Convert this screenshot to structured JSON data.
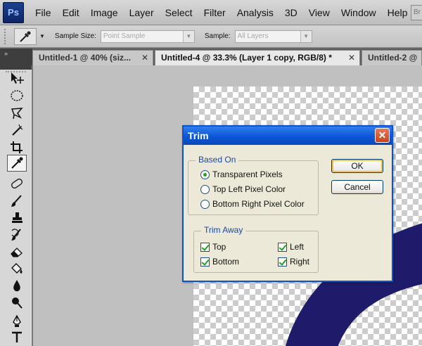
{
  "app": {
    "logo": "Ps"
  },
  "menu": [
    "File",
    "Edit",
    "Image",
    "Layer",
    "Select",
    "Filter",
    "Analysis",
    "3D",
    "View",
    "Window",
    "Help"
  ],
  "menu_right_button": "Br",
  "options": {
    "sample_size_label": "Sample Size:",
    "sample_size_value": "Point Sample",
    "sample_label": "Sample:",
    "sample_value": "All Layers"
  },
  "panel_collapse": "»",
  "tabs": [
    {
      "label": "Untitled-1 @ 40% (siz...",
      "active": false
    },
    {
      "label": "Untitled-4 @ 33.3% (Layer 1 copy, RGB/8) *",
      "active": true
    },
    {
      "label": "Untitled-2 @",
      "active": false
    }
  ],
  "tab_close": "✕",
  "dialog": {
    "title": "Trim",
    "close": "✕",
    "based_on": {
      "title": "Based On",
      "options": [
        {
          "label": "Transparent Pixels",
          "selected": true
        },
        {
          "label": "Top Left Pixel Color",
          "selected": false
        },
        {
          "label": "Bottom Right Pixel Color",
          "selected": false
        }
      ]
    },
    "trim_away": {
      "title": "Trim Away",
      "top": {
        "label": "Top",
        "checked": true
      },
      "bottom": {
        "label": "Bottom",
        "checked": true
      },
      "left": {
        "label": "Left",
        "checked": true
      },
      "right": {
        "label": "Right",
        "checked": true
      }
    },
    "ok_label": "OK",
    "cancel_label": "Cancel"
  },
  "colors": {
    "shape": "#1f1b6b",
    "dialog_border": "#0f52c9",
    "group_title": "#1c47a6"
  }
}
